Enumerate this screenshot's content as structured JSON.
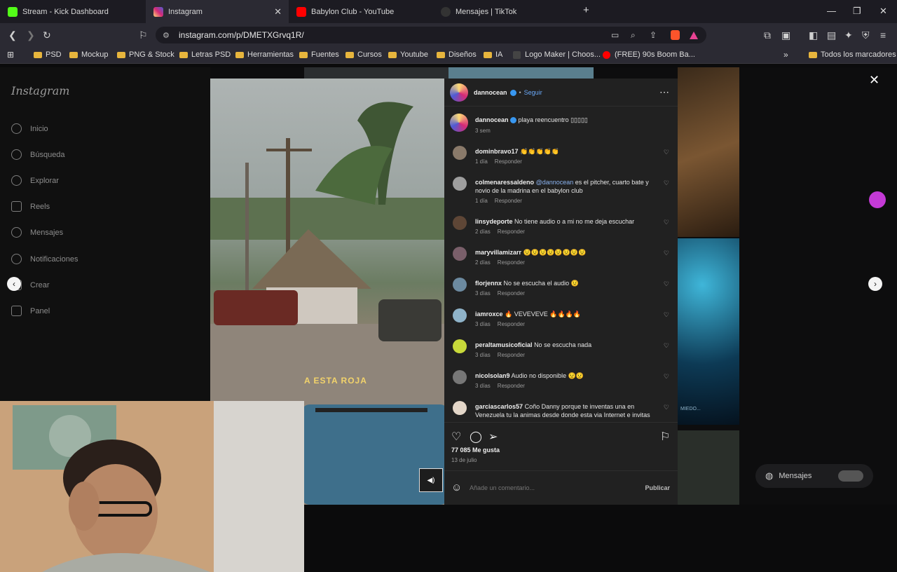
{
  "browser": {
    "tabs": [
      {
        "label": "Stream - Kick Dashboard",
        "color": "#53fc18"
      },
      {
        "label": "Instagram",
        "color": "#d62976",
        "active": true
      },
      {
        "label": "Babylon Club - YouTube",
        "color": "#ff0000"
      },
      {
        "label": "Mensajes | TikTok",
        "color": "#222222"
      }
    ],
    "new_tab": "+",
    "url": "instagram.com/p/DMETXGrvq1R/",
    "bookmarks": [
      "PSD",
      "Mockup",
      "PNG & Stock",
      "Letras PSD",
      "Herramientas",
      "Fuentes",
      "Cursos",
      "Youtube",
      "Diseños",
      "IA",
      "Logo Maker | Choos...",
      "(FREE) 90s Boom Ba..."
    ],
    "all_bookmarks": "Todos los marcadores"
  },
  "instagram": {
    "logo": "Instagram",
    "nav": [
      "Inicio",
      "Búsqueda",
      "Explorar",
      "Reels",
      "Mensajes",
      "Notificaciones",
      "Crear",
      "Panel"
    ],
    "video_caption": "A ESTA ROJA",
    "post": {
      "author": "dannocean",
      "follow": "Seguir",
      "dot": "•",
      "caption": "playa reencuentro ▯▯▯▯▯",
      "caption_time": "3 sem",
      "comments": [
        {
          "user": "dominbravo17",
          "text": "👏👏👏👏👏",
          "time": "1 día",
          "reply": "Responder"
        },
        {
          "user": "colmenaressaldeno",
          "mention": "@dannocean",
          "text": " es el pitcher, cuarto bate y novio de la madrina en el babylon club",
          "time": "1 día",
          "reply": "Responder"
        },
        {
          "user": "linsydeporte",
          "text": "No tiene audio o a mi no me deja escuchar",
          "time": "2 días",
          "reply": "Responder"
        },
        {
          "user": "maryvillamizarr",
          "text": "😟😟😟😟😟😟😟😟",
          "time": "2 días",
          "reply": "Responder"
        },
        {
          "user": "florjennx",
          "text": "No se escucha el audio 😟",
          "time": "3 días",
          "reply": "Responder"
        },
        {
          "user": "iamroxce",
          "text": "🔥 VEVEVEVE 🔥🔥🔥🔥",
          "time": "3 días",
          "reply": "Responder"
        },
        {
          "user": "peraltamusicoficial",
          "text": "No se escucha nada",
          "time": "3 días",
          "reply": "Responder"
        },
        {
          "user": "nicolsolan9",
          "text": "Audio no disponible 😟😟",
          "time": "3 días",
          "reply": "Responder"
        },
        {
          "user": "garciascarlos57",
          "text": "Coño Danny porque te inventas una en Venezuela tu la animas desde donde esta via Internet e invitas",
          "time": "",
          "reply": ""
        }
      ],
      "likes": "77 085 Me gusta",
      "date": "13 de julio",
      "add_comment_placeholder": "Añade un comentario...",
      "publish": "Publicar"
    },
    "bg_tile_text": "MIEDO...",
    "messages_button": "Mensajes"
  }
}
